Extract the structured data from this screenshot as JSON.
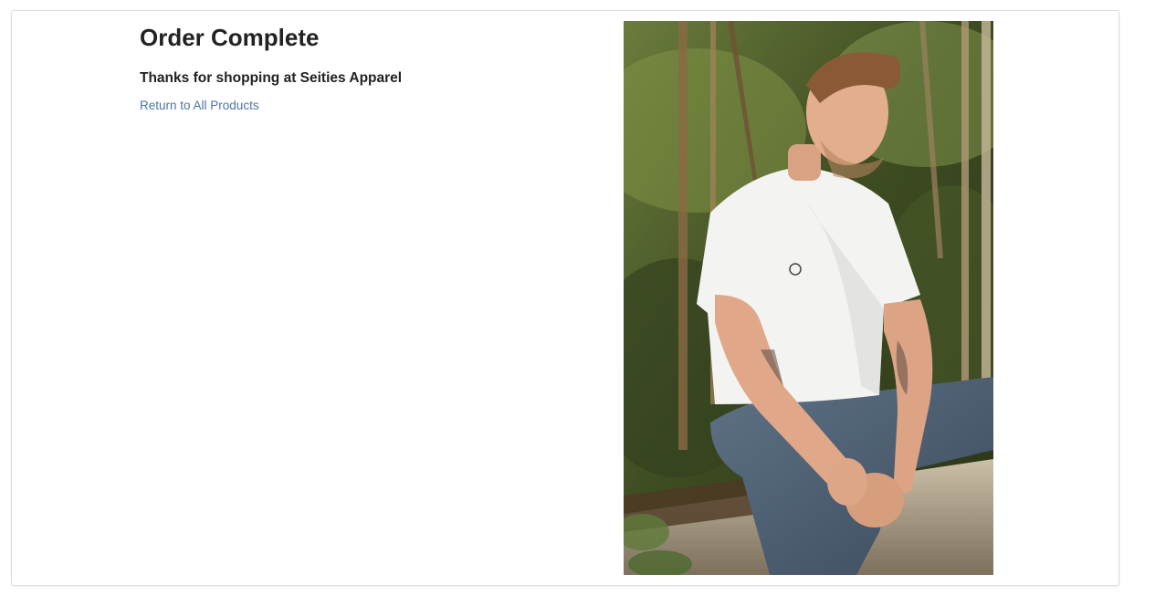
{
  "page": {
    "title": "Order Complete",
    "message": "Thanks for shopping at Seities Apparel",
    "return_link": "Return to All Products"
  },
  "image": {
    "subject": "man in white t-shirt and jeans sitting on a log in a forest",
    "icon_name": "product-photo"
  },
  "colors": {
    "link": "#4a74a8",
    "text": "#222222",
    "card_border": "#dcdcdc"
  }
}
